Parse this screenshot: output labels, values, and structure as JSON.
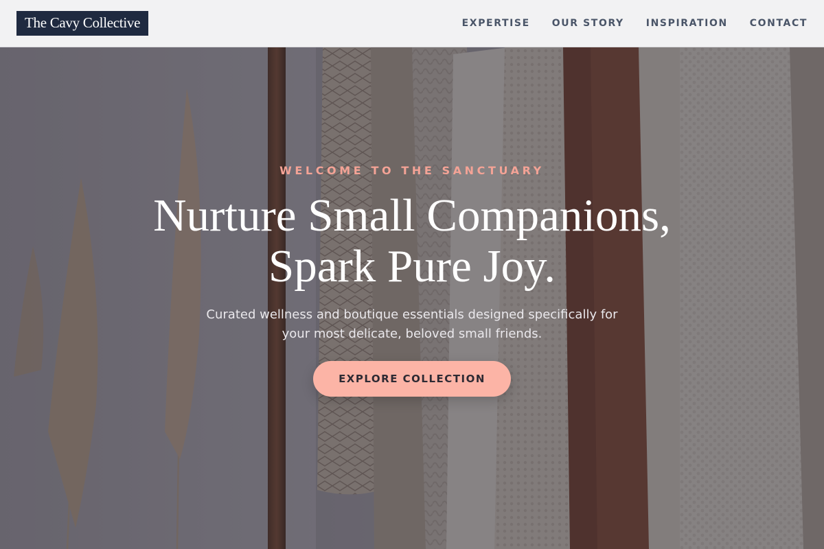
{
  "header": {
    "logo": "The Cavy Collective",
    "nav": [
      {
        "label": "EXPERTISE"
      },
      {
        "label": "OUR STORY"
      },
      {
        "label": "INSPIRATION"
      },
      {
        "label": "CONTACT"
      }
    ]
  },
  "hero": {
    "eyebrow": "WELCOME TO THE SANCTUARY",
    "headline_line1": "Nurture Small Companions,",
    "headline_line2": "Spark Pure Joy.",
    "subtext": "Curated wellness and boutique essentials designed specifically for your most delicate, beloved small friends.",
    "cta_label": "EXPLORE COLLECTION",
    "background_image": "clothing-rack-with-knit-sweaters-and-pampas-grass"
  },
  "colors": {
    "logo_bg": "#1f2a40",
    "nav_text": "#4a5568",
    "eyebrow": "#f4a396",
    "cta_bg": "#fcb4a6",
    "cta_text": "#2d2a33"
  }
}
